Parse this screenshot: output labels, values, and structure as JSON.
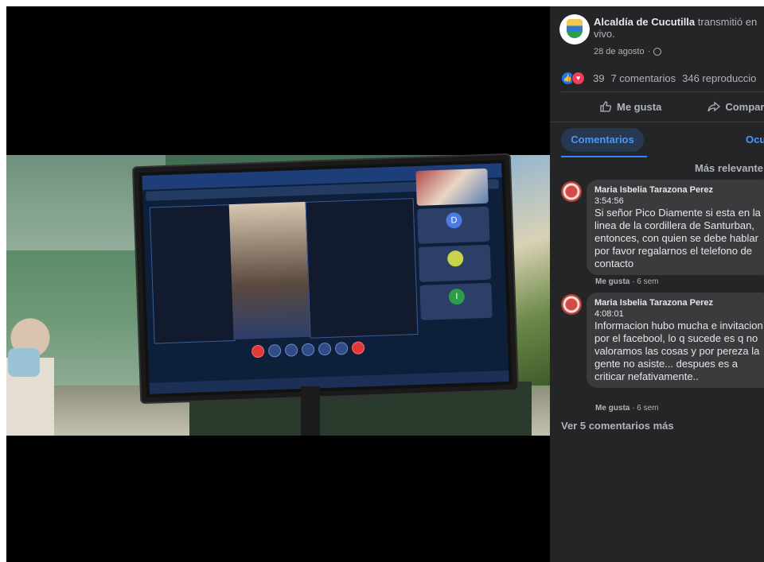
{
  "post": {
    "page_name": "Alcaldía de Cucutilla",
    "action_text": "transmitió",
    "action_text_2": "en vivo.",
    "date": "28 de agosto",
    "privacy_icon": "globe-icon"
  },
  "stats": {
    "reactions_count": "39",
    "comments": "7 comentarios",
    "views": "346 reproduccio"
  },
  "actions": {
    "like_label": "Me gusta",
    "share_label": "Compar",
    "like_icon": "thumbs-up-icon",
    "share_icon": "share-arrow-icon"
  },
  "tabs": {
    "active": "Comentarios",
    "other": "Ocu"
  },
  "sort_label": "Más relevante",
  "comments": [
    {
      "author": "Maria Isbelia Tarazona Perez",
      "timestamp": "3:54:56",
      "text": "Si señor Pico Diamente si esta en la linea de la cordillera de Santurban, entonces, con quien se debe hablar por favor regalarnos el telefono de contacto",
      "like_label": "Me gusta",
      "age": "· 6 sem"
    },
    {
      "author": "Maria Isbelia Tarazona Perez",
      "timestamp": "4:08:01",
      "text": "Informacion hubo mucha e invitacion por el facebool, lo q sucede es q no valoramos las cosas y por pereza la gente no asiste... despues es a criticar nefativamente..",
      "like_label": "Me gusta",
      "age": "· 6 sem"
    }
  ],
  "more_comments": "Ver 5 comentarios más",
  "video": {
    "tile_letter_1": "D",
    "tile_letter_2": "I"
  },
  "colors": {
    "panel_bg": "#242526",
    "bubble_bg": "#3a3b3c",
    "accent": "#4599ff",
    "text_primary": "#e4e6eb",
    "text_secondary": "#b0b3b8",
    "like_blue": "#1877f2",
    "love_red": "#f33e58"
  }
}
